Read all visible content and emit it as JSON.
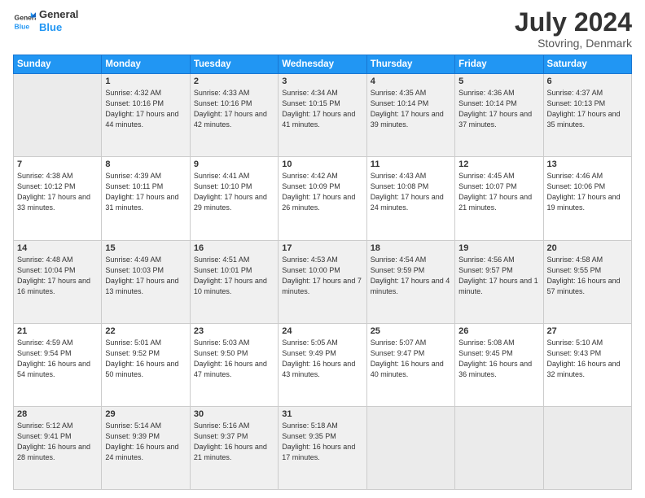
{
  "logo": {
    "line1": "General",
    "line2": "Blue"
  },
  "title": "July 2024",
  "subtitle": "Stovring, Denmark",
  "weekdays": [
    "Sunday",
    "Monday",
    "Tuesday",
    "Wednesday",
    "Thursday",
    "Friday",
    "Saturday"
  ],
  "weeks": [
    [
      {
        "day": "",
        "sunrise": "",
        "sunset": "",
        "daylight": ""
      },
      {
        "day": "1",
        "sunrise": "Sunrise: 4:32 AM",
        "sunset": "Sunset: 10:16 PM",
        "daylight": "Daylight: 17 hours and 44 minutes."
      },
      {
        "day": "2",
        "sunrise": "Sunrise: 4:33 AM",
        "sunset": "Sunset: 10:16 PM",
        "daylight": "Daylight: 17 hours and 42 minutes."
      },
      {
        "day": "3",
        "sunrise": "Sunrise: 4:34 AM",
        "sunset": "Sunset: 10:15 PM",
        "daylight": "Daylight: 17 hours and 41 minutes."
      },
      {
        "day": "4",
        "sunrise": "Sunrise: 4:35 AM",
        "sunset": "Sunset: 10:14 PM",
        "daylight": "Daylight: 17 hours and 39 minutes."
      },
      {
        "day": "5",
        "sunrise": "Sunrise: 4:36 AM",
        "sunset": "Sunset: 10:14 PM",
        "daylight": "Daylight: 17 hours and 37 minutes."
      },
      {
        "day": "6",
        "sunrise": "Sunrise: 4:37 AM",
        "sunset": "Sunset: 10:13 PM",
        "daylight": "Daylight: 17 hours and 35 minutes."
      }
    ],
    [
      {
        "day": "7",
        "sunrise": "Sunrise: 4:38 AM",
        "sunset": "Sunset: 10:12 PM",
        "daylight": "Daylight: 17 hours and 33 minutes."
      },
      {
        "day": "8",
        "sunrise": "Sunrise: 4:39 AM",
        "sunset": "Sunset: 10:11 PM",
        "daylight": "Daylight: 17 hours and 31 minutes."
      },
      {
        "day": "9",
        "sunrise": "Sunrise: 4:41 AM",
        "sunset": "Sunset: 10:10 PM",
        "daylight": "Daylight: 17 hours and 29 minutes."
      },
      {
        "day": "10",
        "sunrise": "Sunrise: 4:42 AM",
        "sunset": "Sunset: 10:09 PM",
        "daylight": "Daylight: 17 hours and 26 minutes."
      },
      {
        "day": "11",
        "sunrise": "Sunrise: 4:43 AM",
        "sunset": "Sunset: 10:08 PM",
        "daylight": "Daylight: 17 hours and 24 minutes."
      },
      {
        "day": "12",
        "sunrise": "Sunrise: 4:45 AM",
        "sunset": "Sunset: 10:07 PM",
        "daylight": "Daylight: 17 hours and 21 minutes."
      },
      {
        "day": "13",
        "sunrise": "Sunrise: 4:46 AM",
        "sunset": "Sunset: 10:06 PM",
        "daylight": "Daylight: 17 hours and 19 minutes."
      }
    ],
    [
      {
        "day": "14",
        "sunrise": "Sunrise: 4:48 AM",
        "sunset": "Sunset: 10:04 PM",
        "daylight": "Daylight: 17 hours and 16 minutes."
      },
      {
        "day": "15",
        "sunrise": "Sunrise: 4:49 AM",
        "sunset": "Sunset: 10:03 PM",
        "daylight": "Daylight: 17 hours and 13 minutes."
      },
      {
        "day": "16",
        "sunrise": "Sunrise: 4:51 AM",
        "sunset": "Sunset: 10:01 PM",
        "daylight": "Daylight: 17 hours and 10 minutes."
      },
      {
        "day": "17",
        "sunrise": "Sunrise: 4:53 AM",
        "sunset": "Sunset: 10:00 PM",
        "daylight": "Daylight: 17 hours and 7 minutes."
      },
      {
        "day": "18",
        "sunrise": "Sunrise: 4:54 AM",
        "sunset": "Sunset: 9:59 PM",
        "daylight": "Daylight: 17 hours and 4 minutes."
      },
      {
        "day": "19",
        "sunrise": "Sunrise: 4:56 AM",
        "sunset": "Sunset: 9:57 PM",
        "daylight": "Daylight: 17 hours and 1 minute."
      },
      {
        "day": "20",
        "sunrise": "Sunrise: 4:58 AM",
        "sunset": "Sunset: 9:55 PM",
        "daylight": "Daylight: 16 hours and 57 minutes."
      }
    ],
    [
      {
        "day": "21",
        "sunrise": "Sunrise: 4:59 AM",
        "sunset": "Sunset: 9:54 PM",
        "daylight": "Daylight: 16 hours and 54 minutes."
      },
      {
        "day": "22",
        "sunrise": "Sunrise: 5:01 AM",
        "sunset": "Sunset: 9:52 PM",
        "daylight": "Daylight: 16 hours and 50 minutes."
      },
      {
        "day": "23",
        "sunrise": "Sunrise: 5:03 AM",
        "sunset": "Sunset: 9:50 PM",
        "daylight": "Daylight: 16 hours and 47 minutes."
      },
      {
        "day": "24",
        "sunrise": "Sunrise: 5:05 AM",
        "sunset": "Sunset: 9:49 PM",
        "daylight": "Daylight: 16 hours and 43 minutes."
      },
      {
        "day": "25",
        "sunrise": "Sunrise: 5:07 AM",
        "sunset": "Sunset: 9:47 PM",
        "daylight": "Daylight: 16 hours and 40 minutes."
      },
      {
        "day": "26",
        "sunrise": "Sunrise: 5:08 AM",
        "sunset": "Sunset: 9:45 PM",
        "daylight": "Daylight: 16 hours and 36 minutes."
      },
      {
        "day": "27",
        "sunrise": "Sunrise: 5:10 AM",
        "sunset": "Sunset: 9:43 PM",
        "daylight": "Daylight: 16 hours and 32 minutes."
      }
    ],
    [
      {
        "day": "28",
        "sunrise": "Sunrise: 5:12 AM",
        "sunset": "Sunset: 9:41 PM",
        "daylight": "Daylight: 16 hours and 28 minutes."
      },
      {
        "day": "29",
        "sunrise": "Sunrise: 5:14 AM",
        "sunset": "Sunset: 9:39 PM",
        "daylight": "Daylight: 16 hours and 24 minutes."
      },
      {
        "day": "30",
        "sunrise": "Sunrise: 5:16 AM",
        "sunset": "Sunset: 9:37 PM",
        "daylight": "Daylight: 16 hours and 21 minutes."
      },
      {
        "day": "31",
        "sunrise": "Sunrise: 5:18 AM",
        "sunset": "Sunset: 9:35 PM",
        "daylight": "Daylight: 16 hours and 17 minutes."
      },
      {
        "day": "",
        "sunrise": "",
        "sunset": "",
        "daylight": ""
      },
      {
        "day": "",
        "sunrise": "",
        "sunset": "",
        "daylight": ""
      },
      {
        "day": "",
        "sunrise": "",
        "sunset": "",
        "daylight": ""
      }
    ]
  ]
}
